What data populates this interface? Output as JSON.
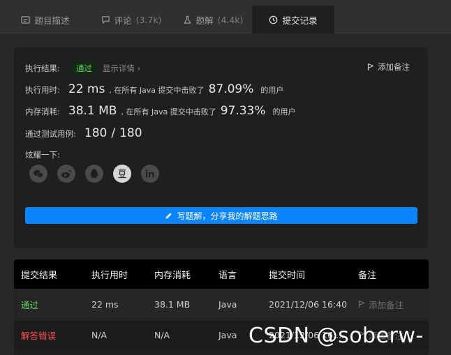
{
  "tabs": [
    {
      "label": "题目描述",
      "count": ""
    },
    {
      "label": "评论",
      "count": "(3.7k)"
    },
    {
      "label": "题解",
      "count": "(4.4k)"
    },
    {
      "label": "提交记录",
      "count": ""
    }
  ],
  "active_tab": "提交记录",
  "result": {
    "status_label": "执行结果:",
    "status_value": "通过",
    "details_link": "显示详情 ›",
    "add_note": "添加备注",
    "runtime": {
      "label": "执行用时:",
      "value": "22 ms",
      "middle": ", 在所有 Java 提交中击败了",
      "percent": "87.09%",
      "suffix": "的用户"
    },
    "memory": {
      "label": "内存消耗:",
      "value": "38.1 MB",
      "middle": ", 在所有 Java 提交中击败了",
      "percent": "97.33%",
      "suffix": "的用户"
    },
    "tests": {
      "label": "通过测试用例:",
      "passed": "180",
      "separator": "/",
      "total": "180"
    },
    "share_label": "炫耀一下:",
    "share_icons": [
      "wechat-icon",
      "weibo-icon",
      "qq-icon",
      "douban-icon",
      "linkedin-icon"
    ],
    "write_button": "写题解，分享我的解题思路"
  },
  "table": {
    "headers": [
      "提交结果",
      "执行用时",
      "内存消耗",
      "语言",
      "提交时间",
      "备注"
    ],
    "rows": [
      {
        "status": "通过",
        "runtime": "22 ms",
        "memory": "38.1 MB",
        "language": "Java",
        "time": "2021/12/06 16:40",
        "note": "添加备注"
      },
      {
        "status": "解答错误",
        "runtime": "N/A",
        "memory": "N/A",
        "language": "Java",
        "time": "2021/12/06 16:...",
        "note": "添加备注"
      }
    ]
  },
  "watermark": "CSDN @soberw-",
  "colors": {
    "accent": "#0a84ff",
    "pass": "#5fd35f",
    "error": "#ff4d4d",
    "background": "#282828",
    "card": "#1f1f1f"
  }
}
